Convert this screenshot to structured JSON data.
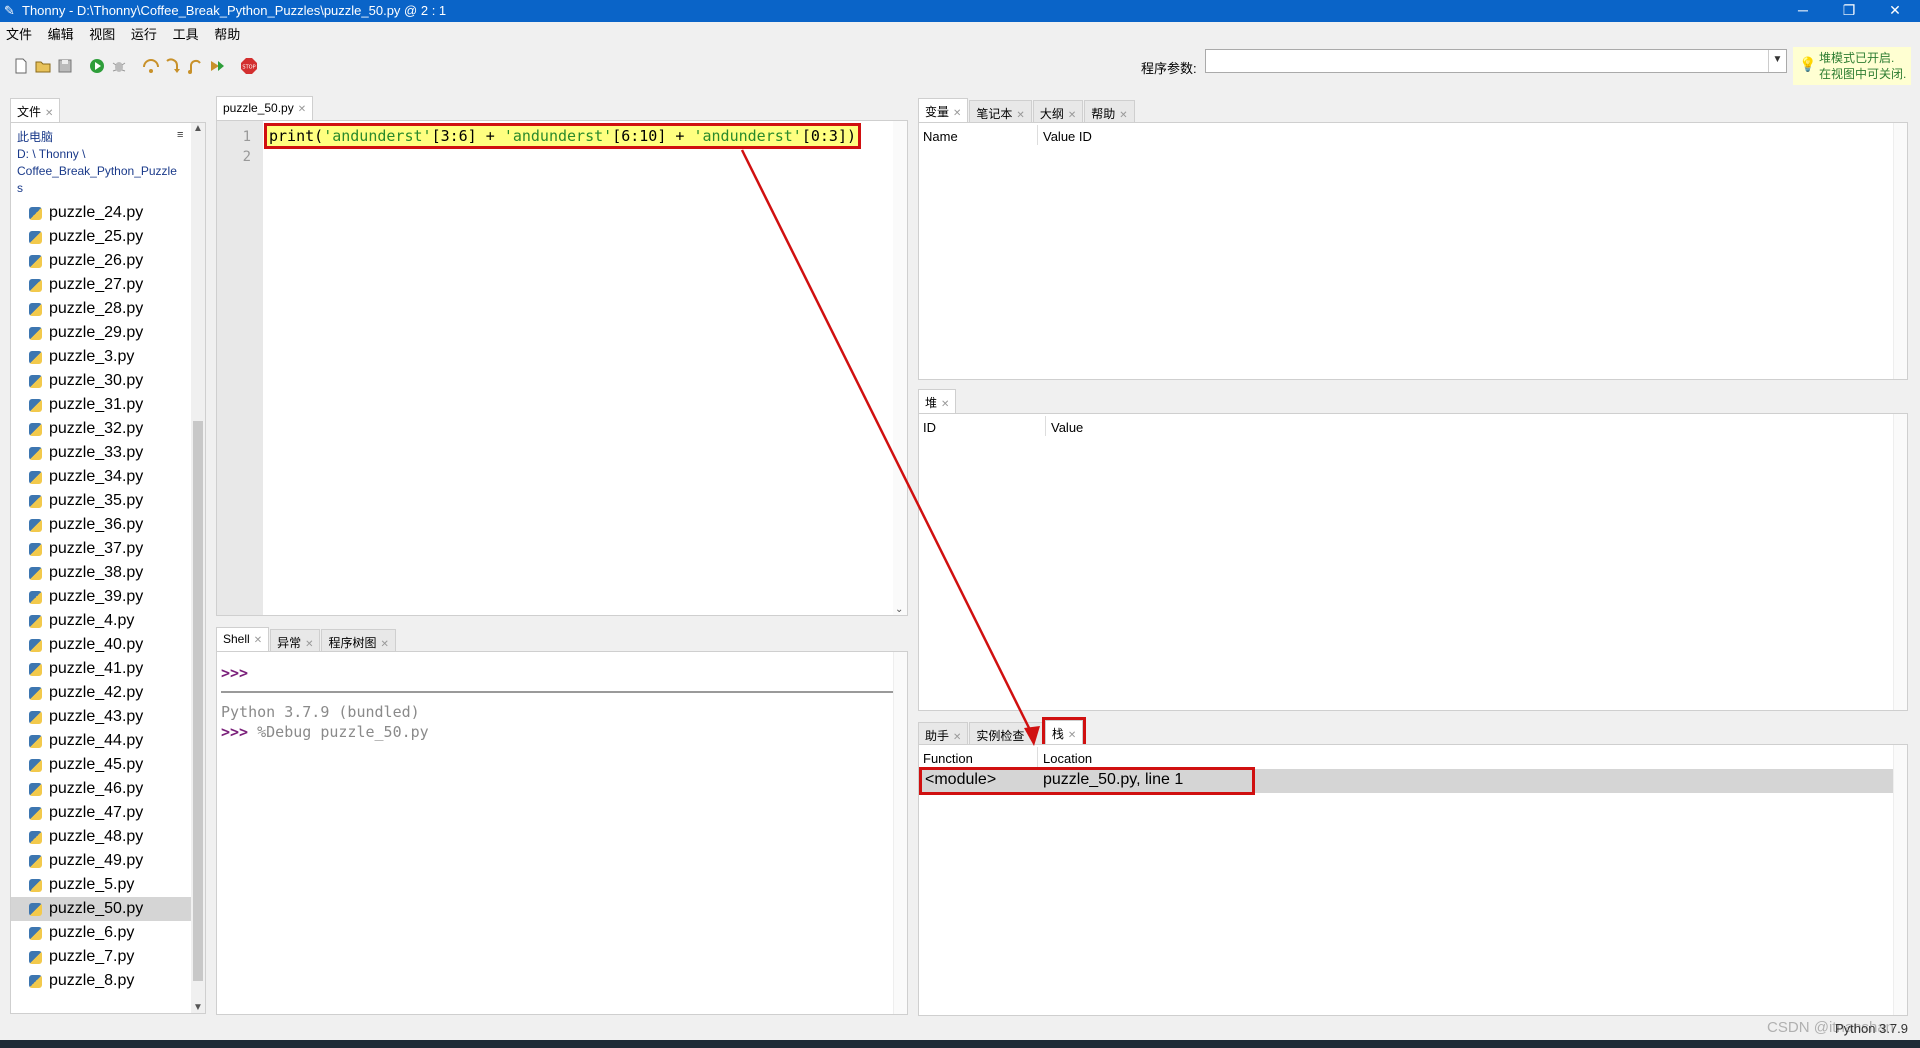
{
  "window": {
    "title": "Thonny  -  D:\\Thonny\\Coffee_Break_Python_Puzzles\\puzzle_50.py  @  2 : 1",
    "minimize": "─",
    "maximize": "❐",
    "close": "✕"
  },
  "menu": [
    "文件",
    "编辑",
    "视图",
    "运行",
    "工具",
    "帮助"
  ],
  "toolbar": {
    "args_label": "程序参数:",
    "args_value": "",
    "notice_line1": "堆模式已开启.",
    "notice_line2": "在视图中可关闭."
  },
  "files": {
    "tab": "文件",
    "path_line1": "此电脑",
    "path_line2": "D: \\ Thonny \\",
    "path_line3": "Coffee_Break_Python_Puzzle",
    "path_line4": "s",
    "menu_icon": "≡",
    "items": [
      "puzzle_24.py",
      "puzzle_25.py",
      "puzzle_26.py",
      "puzzle_27.py",
      "puzzle_28.py",
      "puzzle_29.py",
      "puzzle_3.py",
      "puzzle_30.py",
      "puzzle_31.py",
      "puzzle_32.py",
      "puzzle_33.py",
      "puzzle_34.py",
      "puzzle_35.py",
      "puzzle_36.py",
      "puzzle_37.py",
      "puzzle_38.py",
      "puzzle_39.py",
      "puzzle_4.py",
      "puzzle_40.py",
      "puzzle_41.py",
      "puzzle_42.py",
      "puzzle_43.py",
      "puzzle_44.py",
      "puzzle_45.py",
      "puzzle_46.py",
      "puzzle_47.py",
      "puzzle_48.py",
      "puzzle_49.py",
      "puzzle_5.py",
      "puzzle_50.py",
      "puzzle_6.py",
      "puzzle_7.py",
      "puzzle_8.py"
    ],
    "selected": "puzzle_50.py"
  },
  "editor": {
    "tab": "puzzle_50.py",
    "line1": "1",
    "line2": "2",
    "code_p1": "print(",
    "code_s1": "'andunderst'",
    "code_p2": "[3:6] + ",
    "code_s2": "'andunderst'",
    "code_p3": "[6:10] + ",
    "code_s3": "'andunderst'",
    "code_p4": "[0:3])"
  },
  "bottom_tabs": [
    "Shell",
    "异常",
    "程序树图"
  ],
  "shell": {
    "prompt1": ">>>",
    "banner": "Python 3.7.9 (bundled)",
    "prompt2": ">>>",
    "command": " %Debug puzzle_50.py"
  },
  "vars": {
    "tabs": [
      "变量",
      "笔记本",
      "大纲",
      "帮助"
    ],
    "col_name": "Name",
    "col_value": "Value ID"
  },
  "heap": {
    "tab": "堆",
    "col_id": "ID",
    "col_value": "Value"
  },
  "stack": {
    "tabs": [
      "助手",
      "实例检查",
      "栈"
    ],
    "col_function": "Function",
    "col_location": "Location",
    "row_function": "<module>",
    "row_location": "puzzle_50.py, line 1"
  },
  "status": {
    "python_version": "Python 3.7.9",
    "watermark": "CSDN @itnanshan"
  },
  "colors": {
    "titlebar": "#0a64c8",
    "annotation_red": "#d01010",
    "highlight_yellow": "#ffff80",
    "string_green": "#2a8a2a",
    "prompt_purple": "#7a1f7a"
  }
}
